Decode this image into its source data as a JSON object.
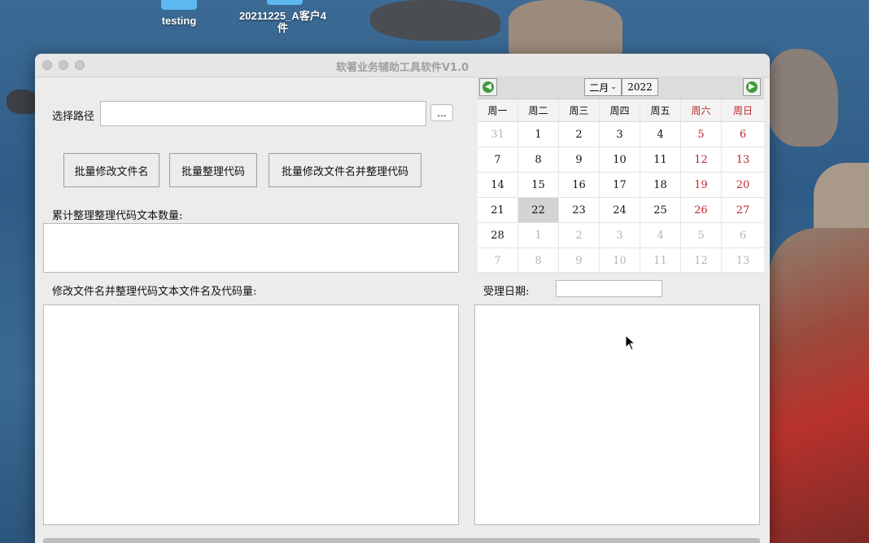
{
  "desktop": {
    "icons": [
      {
        "label": "testing"
      },
      {
        "label": "20211225_A客户4件"
      }
    ]
  },
  "window": {
    "title": "软著业务辅助工具软件V1.0"
  },
  "form": {
    "path_label": "选择路径",
    "path_value": "",
    "browse_label": "...",
    "buttons": {
      "rename": "批量修改文件名",
      "tidy": "批量整理代码",
      "rename_tidy": "批量修改文件名并整理代码"
    },
    "count_label": "累计整理整理代码文本数量:",
    "list_label": "修改文件名并整理代码文本文件名及代码量:",
    "date_label": "受理日期:",
    "date_value": ""
  },
  "calendar": {
    "month": "二月",
    "year": "2022",
    "weekdays": [
      "周一",
      "周二",
      "周三",
      "周四",
      "周五",
      "周六",
      "周日"
    ],
    "weeks": [
      [
        "31",
        "1",
        "2",
        "3",
        "4",
        "5",
        "6"
      ],
      [
        "7",
        "8",
        "9",
        "10",
        "11",
        "12",
        "13"
      ],
      [
        "14",
        "15",
        "16",
        "17",
        "18",
        "19",
        "20"
      ],
      [
        "21",
        "22",
        "23",
        "24",
        "25",
        "26",
        "27"
      ],
      [
        "28",
        "1",
        "2",
        "3",
        "4",
        "5",
        "6"
      ],
      [
        "7",
        "8",
        "9",
        "10",
        "11",
        "12",
        "13"
      ]
    ],
    "selected": "22",
    "colors": {
      "weekend": "#c0262c",
      "other_month": "#b5b5b5",
      "nav": "#3f9b3f"
    }
  }
}
